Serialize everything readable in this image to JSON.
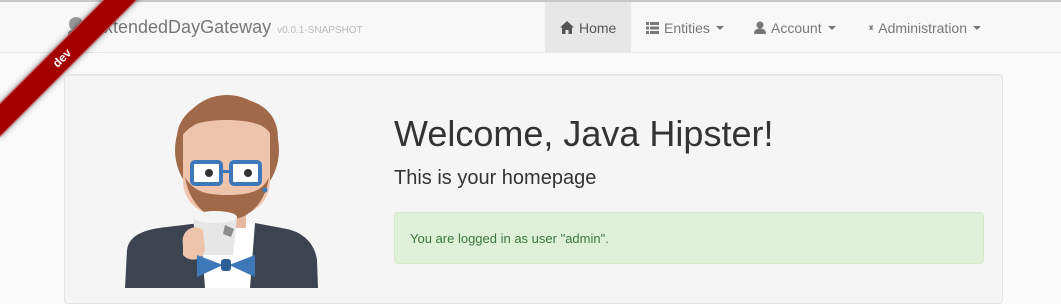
{
  "brand": {
    "name": "ExtendedDayGateway",
    "version": "v0.0.1-SNAPSHOT",
    "ribbon": "dev"
  },
  "nav": {
    "home": "Home",
    "entities": "Entities",
    "account": "Account",
    "administration": "Administration"
  },
  "main": {
    "title": "Welcome, Java Hipster!",
    "subtitle": "This is your homepage",
    "alert": "You are logged in as user \"admin\"."
  },
  "colors": {
    "ribbon": "#a50000",
    "alert_bg": "#dff0d8",
    "alert_text": "#3c763d",
    "nav_active_bg": "#e7e7e7"
  },
  "icons": [
    "home-icon",
    "list-icon",
    "user-icon",
    "tower-icon",
    "brand-logo-icon"
  ]
}
